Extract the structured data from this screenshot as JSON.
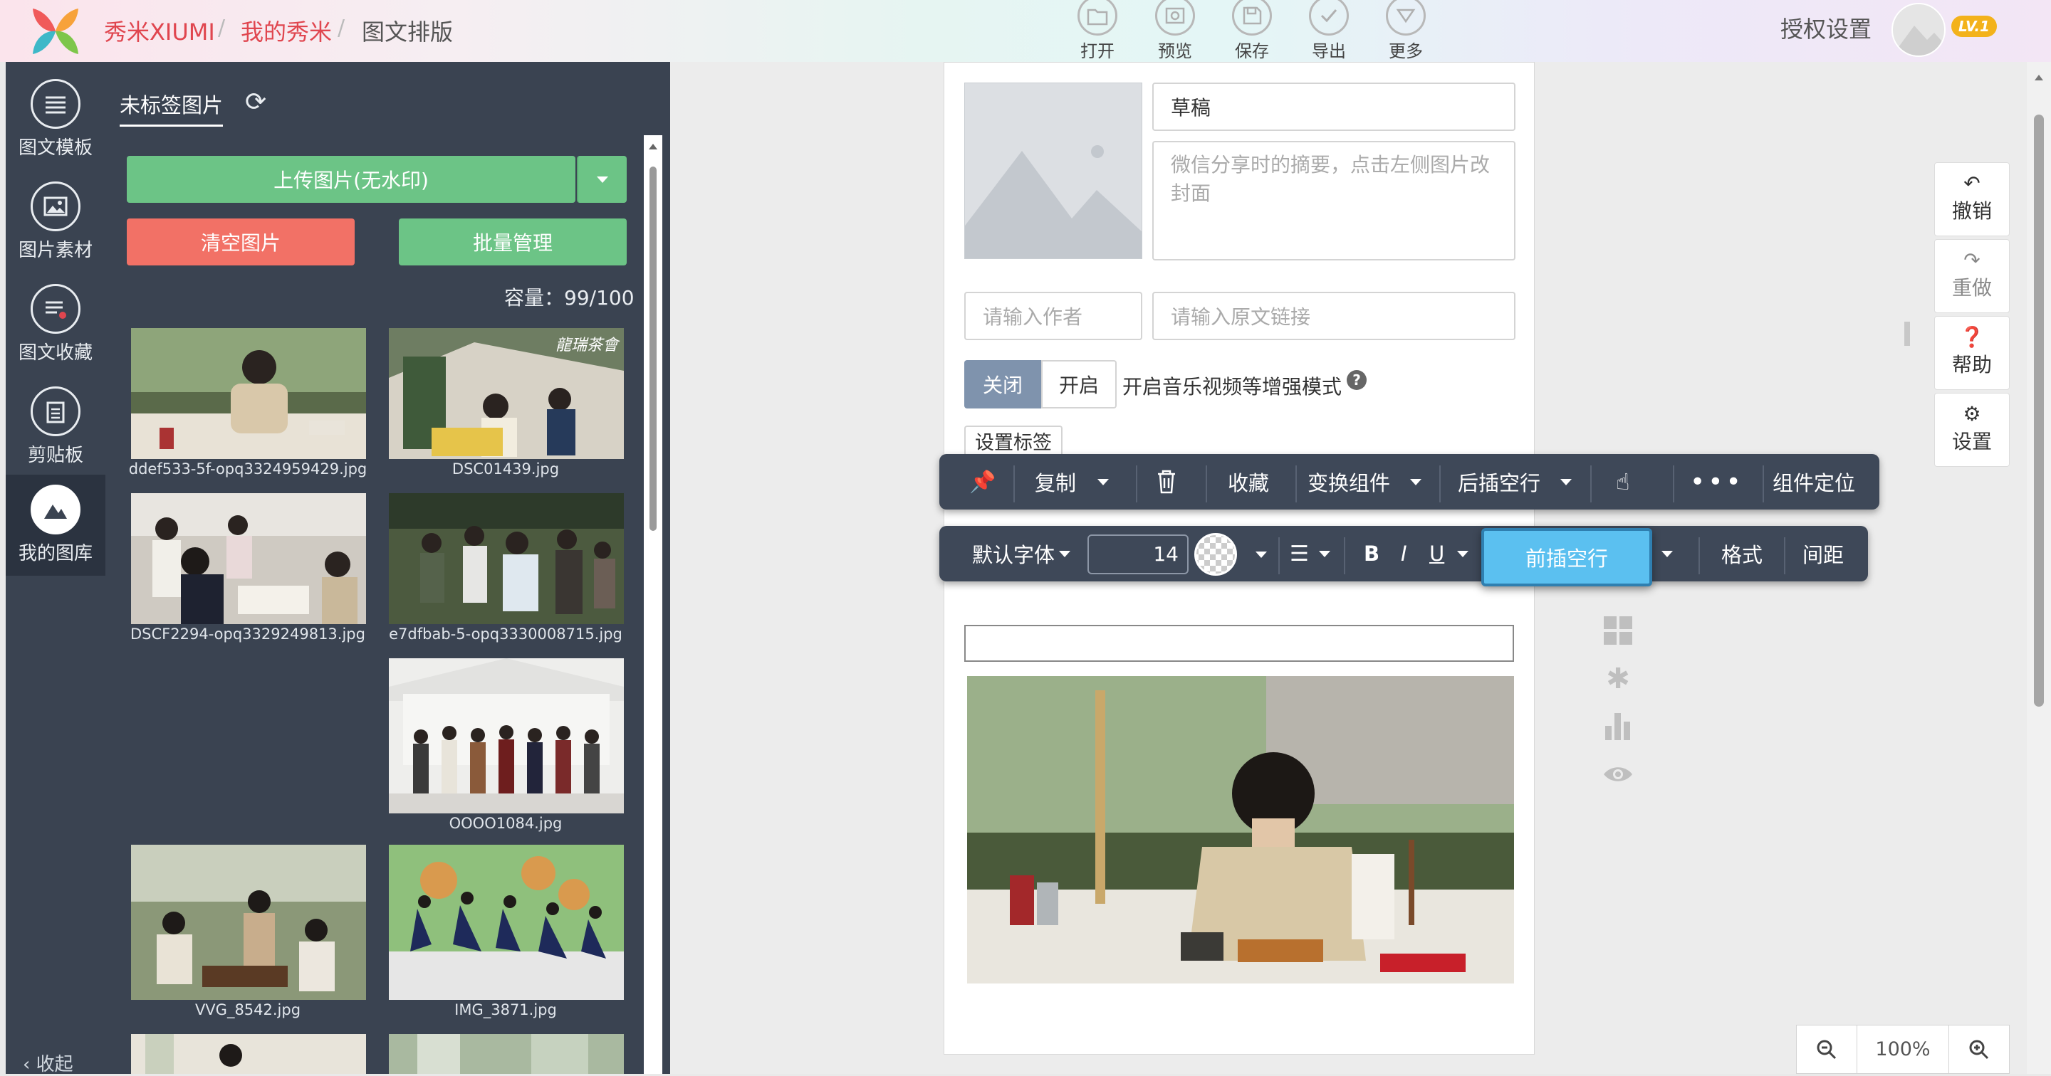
{
  "header": {
    "logo_alt": "xiumi-logo",
    "breadcrumb": [
      "秀米XIUMI",
      "我的秀米",
      "图文排版"
    ],
    "tools": [
      {
        "label": "打开",
        "icon": "folder-icon"
      },
      {
        "label": "预览",
        "icon": "preview-icon"
      },
      {
        "label": "保存",
        "icon": "save-icon"
      },
      {
        "label": "导出",
        "icon": "export-icon"
      },
      {
        "label": "更多",
        "icon": "more-icon"
      }
    ],
    "auth": "授权设置",
    "level": "LV.1"
  },
  "rail": {
    "items": [
      {
        "label": "图文模板",
        "icon": "list-icon"
      },
      {
        "label": "图片素材",
        "icon": "image-icon"
      },
      {
        "label": "图文收藏",
        "icon": "star-list-icon"
      },
      {
        "label": "剪贴板",
        "icon": "clipboard-icon"
      },
      {
        "label": "我的图库",
        "icon": "gallery-icon"
      }
    ],
    "collapse": "收起"
  },
  "library": {
    "tab": "未标签图片",
    "upload": "上传图片(无水印)",
    "clear": "清空图片",
    "batch": "批量管理",
    "capacity": "容量：99/100",
    "images": [
      "ddef533-5f-opq3324959429.jpg",
      "DSC01439.jpg",
      "DSCF2294-opq3329249813.jpg",
      "e7dfbab-5-opq3330008715.jpg",
      "OOOO1084.jpg",
      "VVG_8542.jpg",
      "IMG_3871.jpg"
    ],
    "dsc_watermark": "龍瑞茶會"
  },
  "editor": {
    "title_value": "草稿",
    "summary_placeholder": "微信分享时的摘要，点击左侧图片改封面",
    "author_placeholder": "请输入作者",
    "link_placeholder": "请输入原文链接",
    "mode_off": "关闭",
    "mode_on": "开启",
    "mode_desc": "开启音乐视频等增强模式",
    "tag_button": "设置标签"
  },
  "toolbar1": {
    "copy": "复制",
    "favorite": "收藏",
    "transform": "变换组件",
    "insert_after": "后插空行",
    "locate": "组件定位"
  },
  "toolbar2": {
    "font": "默认字体",
    "size": "14",
    "bold": "B",
    "italic": "I",
    "underline": "U",
    "insert_before": "前插空行",
    "format": "格式",
    "spacing": "间距"
  },
  "side": {
    "undo": "撤销",
    "redo": "重做",
    "help": "帮助",
    "settings": "设置"
  },
  "zoom": {
    "level": "100%"
  },
  "colors": {
    "green": "#6cc486",
    "red": "#f27166",
    "dark": "#3a4351",
    "highlight": "#5bc0f0",
    "crumb_red": "#e0464f",
    "badge": "#f3b21b"
  }
}
